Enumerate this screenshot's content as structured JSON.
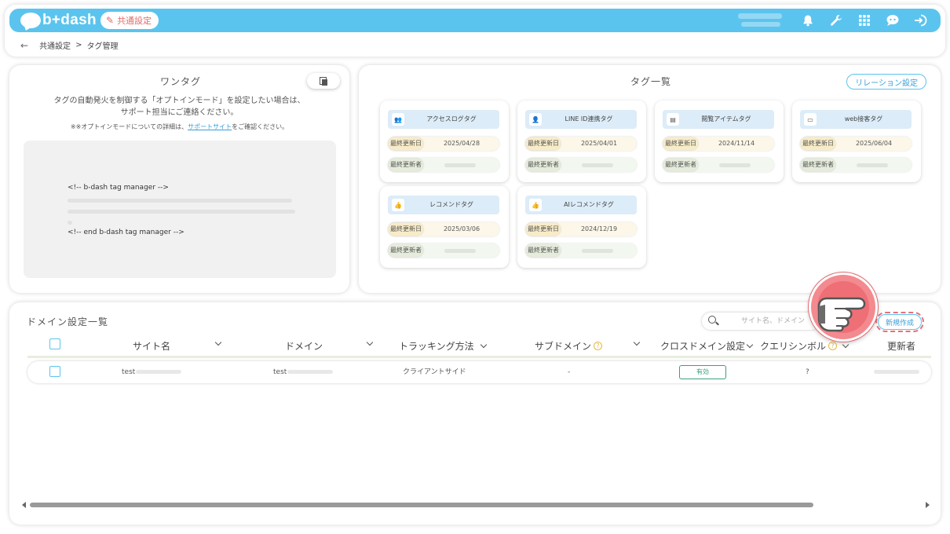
{
  "header": {
    "logo": "b+dash",
    "common_settings": "共通設定",
    "breadcrumb": {
      "parent": "共通設定",
      "separator": ">",
      "current": "タグ管理"
    }
  },
  "onetag": {
    "title": "ワンタグ",
    "desc_line1": "タグの自動発火を制御する「オプトインモード」を設定したい場合は、",
    "desc_line2": "サポート担当にご連絡ください。",
    "note_before": "※※オプトインモードについての詳細は、",
    "note_link": "サポートサイト",
    "note_after": "をご確認ください。",
    "code_start": "<!-- b-dash tag manager -->",
    "code_end": "<!-- end b-dash tag manager -->"
  },
  "taglist": {
    "title": "タグ一覧",
    "relation_button": "リレーション設定",
    "label_updated": "最終更新日",
    "label_updater": "最終更新者",
    "cards": [
      {
        "name": "アクセスログタグ",
        "icon": "users-icon",
        "date": "2025/04/28"
      },
      {
        "name": "LINE ID連携タグ",
        "icon": "person-icon",
        "date": "2025/04/01"
      },
      {
        "name": "閲覧アイテムタグ",
        "icon": "book-icon",
        "date": "2024/11/14"
      },
      {
        "name": "web接客タグ",
        "icon": "monitor-icon",
        "date": "2025/06/04"
      },
      {
        "name": "レコメンドタグ",
        "icon": "thumbs-up-icon",
        "date": "2025/03/06"
      },
      {
        "name": "AIレコメンドタグ",
        "icon": "thumbs-up-icon",
        "date": "2024/12/19"
      }
    ]
  },
  "domain": {
    "title": "ドメイン設定一覧",
    "search_placeholder": "サイト名、ドメイン",
    "new_button": "新規作成",
    "columns": {
      "site": "サイト名",
      "domain": "ドメイン",
      "tracking": "トラッキング方法",
      "subdomain": "サブドメイン",
      "cross": "クロスドメイン設定",
      "query": "クエリシンボル",
      "updater": "更新者",
      "help": "?"
    },
    "row": {
      "site": "test",
      "domain": "test",
      "tracking": "クライアントサイド",
      "subdomain": "-",
      "cross": "有効",
      "query": "?"
    }
  },
  "colors": {
    "accent": "#5bc4ee",
    "pointer": "#ef6f77",
    "badge": "#3aa07a"
  }
}
